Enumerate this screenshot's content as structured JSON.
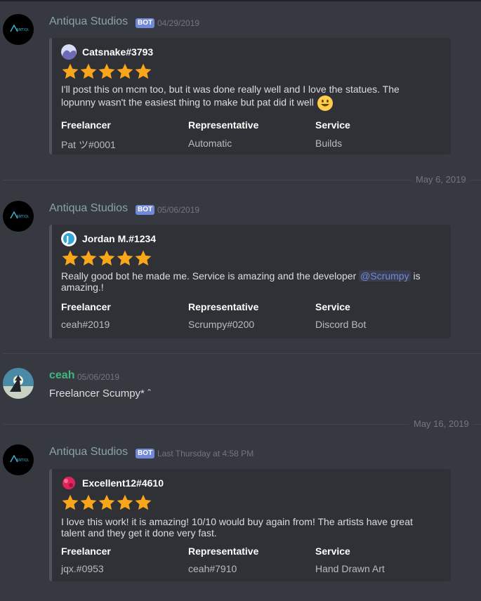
{
  "colors": {
    "background": "#36393f",
    "embed_bg": "#2f3136",
    "star": "#faa61a",
    "bot_badge": "#7289da",
    "author_teal": "#8aa3a6",
    "author_green": "#43b581"
  },
  "messages": [
    {
      "author": "Antiqua Studios",
      "badge": "BOT",
      "timestamp": "04/29/2019",
      "avatar_icon": "antiqua-logo-icon",
      "embed": {
        "author": "Catsnake#3793",
        "author_icon": "catsnake-avatar-icon",
        "rating": 5,
        "description": "I'll post this on mcm too, but it was done really well and I love the statues. The lopunny wasn't the easiest thing to make but pat did it well",
        "emoji": "smiley-emoji-icon",
        "fields": [
          {
            "name": "Freelancer",
            "value": "Pat ツ#0001"
          },
          {
            "name": "Representative",
            "value": "Automatic"
          },
          {
            "name": "Service",
            "value": "Builds"
          }
        ]
      }
    },
    {
      "author": "Antiqua Studios",
      "badge": "BOT",
      "timestamp": "05/06/2019",
      "avatar_icon": "antiqua-logo-icon",
      "embed": {
        "author": "Jordan M.#1234",
        "author_icon": "jordan-avatar-icon",
        "rating": 5,
        "description_before": "Really good bot he made me. Service is amazing and the developer ",
        "mention": "@Scrumpy",
        "description_after": " is amazing.!",
        "fields": [
          {
            "name": "Freelancer",
            "value": "ceah#2019"
          },
          {
            "name": "Representative",
            "value": "Scrumpy#0200"
          },
          {
            "name": "Service",
            "value": "Discord Bot"
          }
        ]
      }
    },
    {
      "author": "ceah",
      "timestamp": "05/06/2019",
      "avatar_icon": "ceah-avatar-icon",
      "content": "Freelancer Scumpy* ˆ"
    },
    {
      "author": "Antiqua Studios",
      "badge": "BOT",
      "timestamp": "Last Thursday at 4:58 PM",
      "avatar_icon": "antiqua-logo-icon",
      "embed": {
        "author": "Excellent12#4610",
        "author_icon": "excellent-avatar-icon",
        "rating": 5,
        "description": "I love this work! it is amazing! 10/10 would buy again from! The artists have great talent and they get it done very fast.",
        "fields": [
          {
            "name": "Freelancer",
            "value": "jqx.#0953"
          },
          {
            "name": "Representative",
            "value": "ceah#7910"
          },
          {
            "name": "Service",
            "value": "Hand Drawn Art"
          }
        ]
      }
    }
  ],
  "dividers": [
    "May 6, 2019",
    "May 16, 2019"
  ]
}
